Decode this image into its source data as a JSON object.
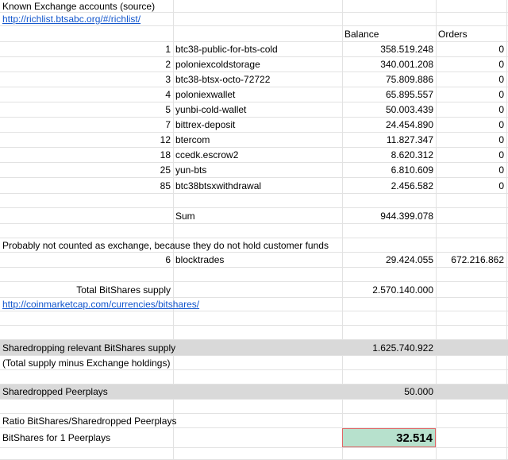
{
  "header": {
    "title": "Known Exchange accounts (source)",
    "source_link": "http://richlist.btsabc.org/#/richlist/",
    "col_balance": "Balance",
    "col_orders": "Orders"
  },
  "exchanges": [
    {
      "rank": "1",
      "name": "btc38-public-for-bts-cold",
      "balance": "358.519.248",
      "orders": "0"
    },
    {
      "rank": "2",
      "name": "poloniexcoldstorage",
      "balance": "340.001.208",
      "orders": "0"
    },
    {
      "rank": "3",
      "name": "btc38-btsx-octo-72722",
      "balance": "75.809.886",
      "orders": "0"
    },
    {
      "rank": "4",
      "name": "poloniexwallet",
      "balance": "65.895.557",
      "orders": "0"
    },
    {
      "rank": "5",
      "name": "yunbi-cold-wallet",
      "balance": "50.003.439",
      "orders": "0"
    },
    {
      "rank": "7",
      "name": "bittrex-deposit",
      "balance": "24.454.890",
      "orders": "0"
    },
    {
      "rank": "12",
      "name": "btercom",
      "balance": "11.827.347",
      "orders": "0"
    },
    {
      "rank": "18",
      "name": "ccedk.escrow2",
      "balance": "8.620.312",
      "orders": "0"
    },
    {
      "rank": "25",
      "name": "yun-bts",
      "balance": "6.810.609",
      "orders": "0"
    },
    {
      "rank": "85",
      "name": "btc38btsxwithdrawal",
      "balance": "2.456.582",
      "orders": "0"
    }
  ],
  "sum": {
    "label": "Sum",
    "value": "944.399.078"
  },
  "not_counted": {
    "note": "Probably not counted as exchange, because they do not hold customer funds",
    "rank": "6",
    "name": "blocktrades",
    "balance": "29.424.055",
    "orders": "672.216.862"
  },
  "total_supply": {
    "label": "Total BitShares supply",
    "value": "2.570.140.000"
  },
  "coinmarketcap_link": "http://coinmarketcap.com/currencies/bitshares/",
  "sharedrop_supply": {
    "label": "Sharedropping relevant BitShares supply",
    "value": "1.625.740.922",
    "note": "(Total supply minus Exchange holdings)"
  },
  "sharedropped_peerplays": {
    "label": "Sharedropped Peerplays",
    "value": "50.000"
  },
  "ratio": {
    "label": "Ratio BitShares/Sharedropped Peerplays"
  },
  "result": {
    "label": "BitShares for 1 Peerplays",
    "value": "32.514"
  },
  "colors": {
    "highlight_row": "#d9d9d9",
    "result_fill": "#b7e1cd",
    "result_border": "#e06666",
    "link": "#1155cc"
  }
}
